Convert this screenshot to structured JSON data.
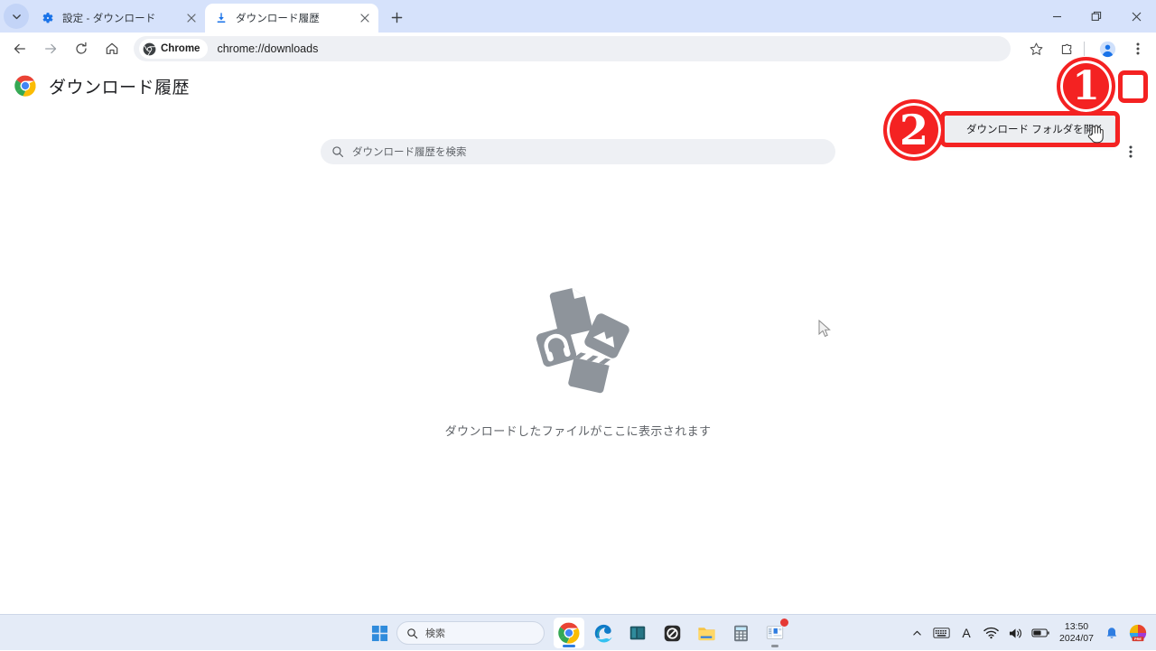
{
  "window": {
    "controls": {
      "minimize": "−",
      "restore": "❐",
      "close": "✕"
    }
  },
  "tabstrip": {
    "tab_search_icon": "chevron-down-icon",
    "new_tab_label": "+",
    "tabs": [
      {
        "title": "設定 - ダウンロード",
        "favicon": "gear-icon",
        "active": false,
        "close_label": "✕"
      },
      {
        "title": "ダウンロード履歴",
        "favicon": "download-icon",
        "active": true,
        "close_label": "✕"
      }
    ]
  },
  "toolbar": {
    "back_icon": "arrow-left-icon",
    "forward_icon": "arrow-right-icon",
    "reload_icon": "reload-icon",
    "home_icon": "home-icon",
    "chip_label": "Chrome",
    "chip_icon": "chrome-icon",
    "url": "chrome://downloads",
    "bookmark_icon": "star-icon",
    "extensions_icon": "extensions-icon",
    "profile_icon": "profile-avatar-icon",
    "menu_icon": "three-dot-menu-icon"
  },
  "page": {
    "title": "ダウンロード履歴",
    "logo_icon": "chrome-logo-icon",
    "search": {
      "icon": "search-icon",
      "placeholder": "ダウンロード履歴を検索",
      "value": ""
    },
    "kebab_icon": "three-dot-menu-icon",
    "empty_state": {
      "text": "ダウンロードしたファイルがここに表示されます",
      "art_icons": [
        "document-icon",
        "image-icon",
        "audio-icon",
        "video-clapper-icon"
      ]
    }
  },
  "dropdown": {
    "items": [
      {
        "label": "ダウンロード フォルダを開く"
      }
    ]
  },
  "annotations": {
    "colors": {
      "highlight": "#f42222",
      "fill": "#ffffff"
    },
    "markers": [
      {
        "number": "1",
        "target": "page-kebab-menu-button"
      },
      {
        "number": "2",
        "target": "open-downloads-folder-menu-item"
      }
    ]
  },
  "taskbar": {
    "start_icon": "windows-start-icon",
    "search": {
      "icon": "search-icon",
      "placeholder": "検索",
      "value": ""
    },
    "apps": [
      {
        "name": "chrome-taskbar-icon",
        "running": true,
        "badge": false
      },
      {
        "name": "edge-taskbar-icon",
        "running": false,
        "badge": false
      },
      {
        "name": "panels-taskbar-icon",
        "running": false,
        "badge": false
      },
      {
        "name": "zero-app-taskbar-icon",
        "running": false,
        "badge": false
      },
      {
        "name": "file-explorer-taskbar-icon",
        "running": false,
        "badge": false
      },
      {
        "name": "calculator-taskbar-icon",
        "running": false,
        "badge": false
      },
      {
        "name": "settings-app-taskbar-icon",
        "running": true,
        "badge": true
      }
    ],
    "tray": {
      "overflow_icon": "chevron-up-icon",
      "keyboard_icon": "keyboard-icon",
      "ime_label": "A",
      "wifi_icon": "wifi-icon",
      "volume_icon": "volume-icon",
      "battery_icon": "battery-icon",
      "clock_time": "13:50",
      "clock_date": "2024/07",
      "notification_icon": "bell-icon",
      "app_badge_label": "PRE"
    }
  }
}
